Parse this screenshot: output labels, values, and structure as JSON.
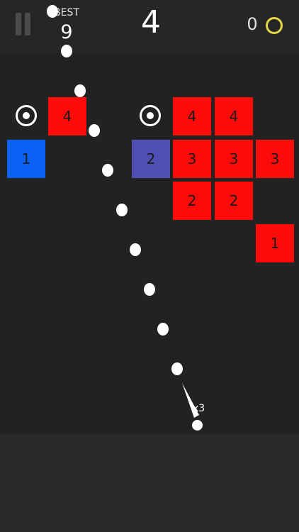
{
  "hud": {
    "best_label": "BEST",
    "best_value": "9",
    "score": "4",
    "coins": "0",
    "coin_color": "#e6d84a"
  },
  "colors": {
    "red": "#ff0a0a",
    "blue": "#0a63f5",
    "purple": "#4f4fb4",
    "background": "#222222"
  },
  "bricks": [
    {
      "label": "4",
      "color": "red"
    },
    {
      "label": "1",
      "color": "blue"
    },
    {
      "label": "2",
      "color": "purple"
    },
    {
      "label": "4",
      "color": "red"
    },
    {
      "label": "4",
      "color": "red"
    },
    {
      "label": "3",
      "color": "red"
    },
    {
      "label": "3",
      "color": "red"
    },
    {
      "label": "3",
      "color": "red"
    },
    {
      "label": "2",
      "color": "red"
    },
    {
      "label": "2",
      "color": "red"
    },
    {
      "label": "1",
      "color": "red"
    }
  ],
  "pickups": [
    {
      "icon": "extra-ball-ring-icon"
    },
    {
      "icon": "extra-ball-ring-icon"
    }
  ],
  "launcher": {
    "ball_count": "x3"
  }
}
